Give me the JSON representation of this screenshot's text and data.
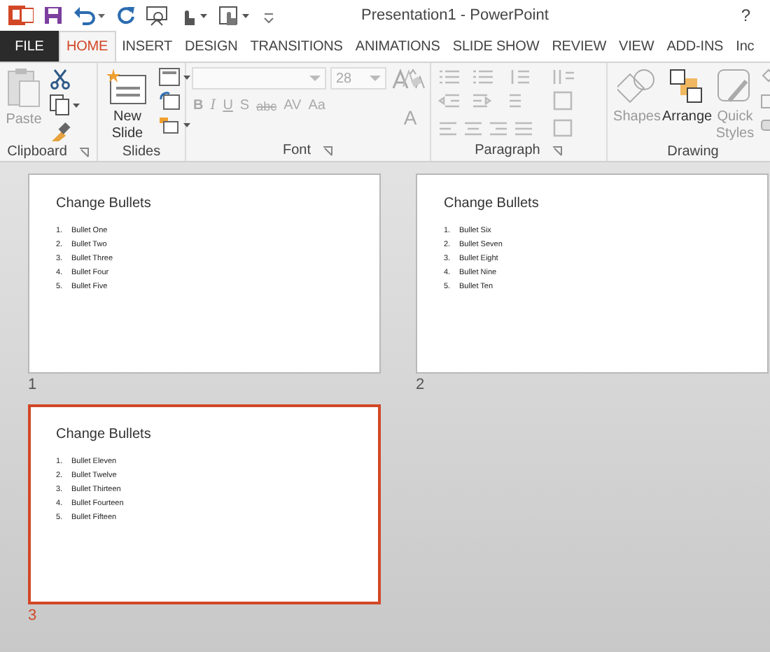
{
  "window": {
    "title": "Presentation1 - PowerPoint",
    "help": "?"
  },
  "tabs": [
    {
      "label": "FILE",
      "kind": "file",
      "selected": false
    },
    {
      "label": "HOME",
      "kind": "tab",
      "selected": true
    },
    {
      "label": "INSERT",
      "kind": "tab",
      "selected": false
    },
    {
      "label": "DESIGN",
      "kind": "tab",
      "selected": false
    },
    {
      "label": "TRANSITIONS",
      "kind": "tab",
      "selected": false
    },
    {
      "label": "ANIMATIONS",
      "kind": "tab",
      "selected": false
    },
    {
      "label": "SLIDE SHOW",
      "kind": "tab",
      "selected": false
    },
    {
      "label": "REVIEW",
      "kind": "tab",
      "selected": false
    },
    {
      "label": "VIEW",
      "kind": "tab",
      "selected": false
    },
    {
      "label": "ADD-INS",
      "kind": "tab",
      "selected": false
    },
    {
      "label": "Inc",
      "kind": "tab",
      "selected": false
    }
  ],
  "ribbon": {
    "clipboard": {
      "paste": {
        "label": "Paste",
        "disabled": true
      },
      "label": "Clipboard"
    },
    "slides": {
      "new_slide": "New Slide",
      "label": "Slides"
    },
    "font": {
      "size": "28",
      "buttons": [
        "B",
        "I",
        "U",
        "S",
        "abc",
        "AV",
        "Aa"
      ],
      "color_button": "A",
      "label": "Font"
    },
    "paragraph": {
      "label": "Paragraph"
    },
    "drawing": {
      "buttons": [
        {
          "label": "Shapes",
          "kind": "shapes",
          "disabled": true
        },
        {
          "label": "Arrange",
          "kind": "arrange",
          "disabled": false
        },
        {
          "label": "Quick Styles",
          "kind": "styles",
          "disabled": true
        }
      ],
      "label": "Drawing"
    }
  },
  "slides": [
    {
      "number": "1",
      "title": "Change Bullets",
      "selected": false,
      "bullets": [
        {
          "number": "1.",
          "text": "Bullet One"
        },
        {
          "number": "2.",
          "text": "Bullet Two"
        },
        {
          "number": "3.",
          "text": "Bullet Three"
        },
        {
          "number": "4.",
          "text": "Bullet Four"
        },
        {
          "number": "5.",
          "text": "Bullet Five"
        }
      ]
    },
    {
      "number": "2",
      "title": "Change Bullets",
      "selected": false,
      "bullets": [
        {
          "number": "1.",
          "text": "Bullet Six"
        },
        {
          "number": "2.",
          "text": "Bullet Seven"
        },
        {
          "number": "3.",
          "text": "Bullet Eight"
        },
        {
          "number": "4.",
          "text": "Bullet Nine"
        },
        {
          "number": "5.",
          "text": "Bullet Ten"
        }
      ]
    },
    {
      "number": "3",
      "title": "Change Bullets",
      "selected": true,
      "bullets": [
        {
          "number": "1.",
          "text": "Bullet Eleven"
        },
        {
          "number": "2.",
          "text": "Bullet Twelve"
        },
        {
          "number": "3.",
          "text": "Bullet Thirteen"
        },
        {
          "number": "4.",
          "text": "Bullet Fourteen"
        },
        {
          "number": "5.",
          "text": "Bullet Fifteen"
        }
      ]
    }
  ]
}
